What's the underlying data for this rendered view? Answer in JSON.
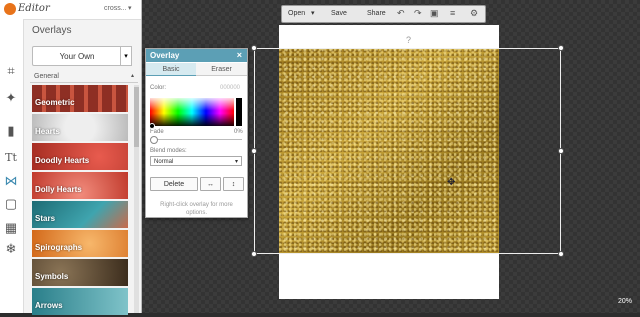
{
  "app": {
    "logo_text": "Editor",
    "user": "cross..."
  },
  "sidebar": {
    "title": "Overlays",
    "own_button": "Your Own",
    "category": "General",
    "tools": [
      {
        "name": "crop-icon",
        "glyph": "⌗"
      },
      {
        "name": "magic-wand-icon",
        "glyph": "✦"
      },
      {
        "name": "brush-icon",
        "glyph": "▮"
      },
      {
        "name": "text-icon",
        "glyph": "Tt"
      },
      {
        "name": "butterfly-icon",
        "glyph": "⋈"
      },
      {
        "name": "frame-icon",
        "glyph": "▢"
      },
      {
        "name": "texture-icon",
        "glyph": "▦"
      },
      {
        "name": "snowflake-icon",
        "glyph": "❄"
      }
    ],
    "tiles": [
      {
        "label": "Geometric",
        "color": "#b03a2e"
      },
      {
        "label": "Hearts",
        "color": "#d9d9d9"
      },
      {
        "label": "Doodly Hearts",
        "color": "#c0392b"
      },
      {
        "label": "Dolly Hearts",
        "color": "#e74c3c"
      },
      {
        "label": "Stars",
        "color": "#1f6f78"
      },
      {
        "label": "Spirographs",
        "color": "#e67e22"
      },
      {
        "label": "Symbols",
        "color": "#4a3b2a"
      },
      {
        "label": "Arrows",
        "color": "#2a7f8a"
      }
    ]
  },
  "toolbar": {
    "open": "Open",
    "save": "Save",
    "share": "Share",
    "icons": [
      "undo-icon",
      "redo-icon",
      "compare-icon",
      "layers-icon",
      "settings-icon"
    ]
  },
  "overlay_dialog": {
    "title": "Overlay",
    "close": "×",
    "tabs": [
      "Basic",
      "Eraser"
    ],
    "color_label": "Color:",
    "color_value": "000000",
    "fade_label": "Fade",
    "fade_value": "0%",
    "fade_level": 0,
    "blend_label": "Blend modes:",
    "blend_value": "Normal",
    "delete": "Delete",
    "flip_h": "↔",
    "flip_v": "↕",
    "hint": "Right-click overlay for more options."
  },
  "canvas": {
    "zoom": "20%",
    "rotate_glyph": "?"
  },
  "colors": {
    "accent": "#5c9fb5",
    "glitter": "#b8952f"
  }
}
